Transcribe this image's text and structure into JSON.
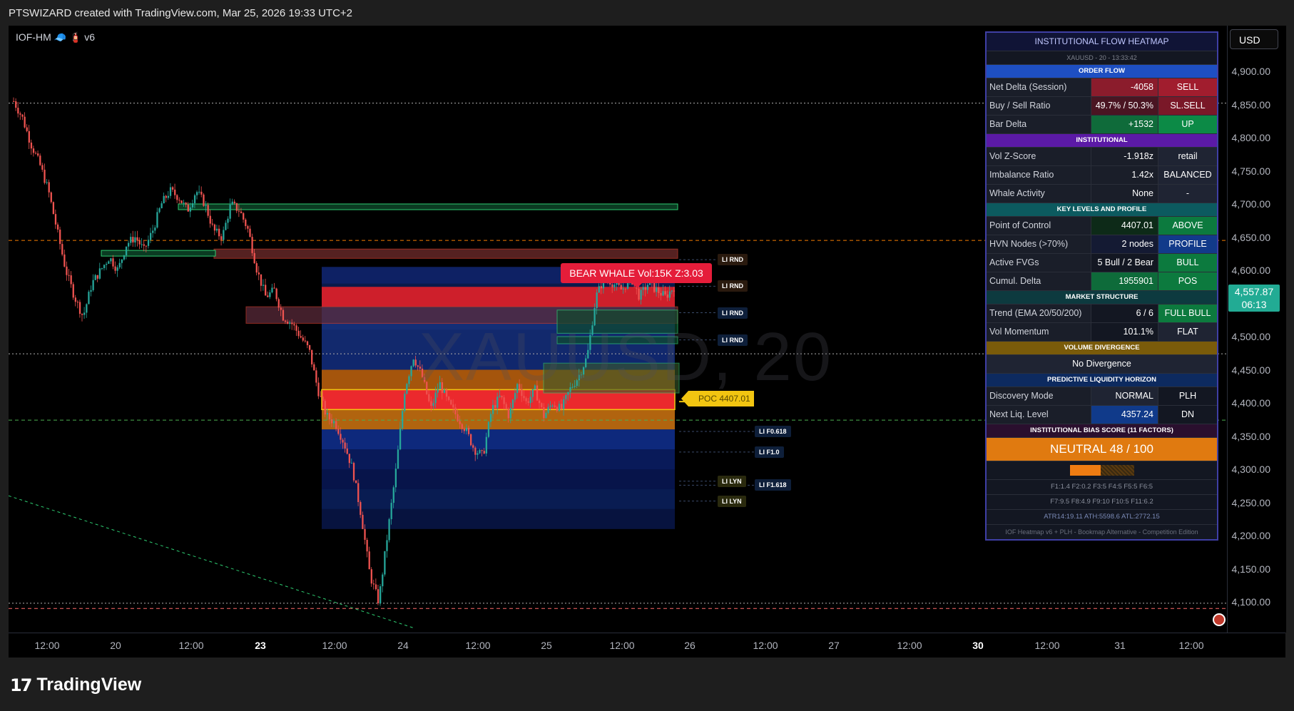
{
  "header": {
    "title": "PTSWIZARD created with TradingView.com, Mar 25, 2026 19:33 UTC+2"
  },
  "indicator_label": "IOF-HM 🧢 🧯 v6",
  "currency_button": "USD",
  "watermark": "XAUUSD, 20",
  "brand": {
    "logo_text": "TradingView",
    "logo_mark": "17"
  },
  "last_price": {
    "value": "4,557.87",
    "countdown": "06:13"
  },
  "annotations": {
    "whale": "BEAR WHALE Vol:15K Z:3.03",
    "poc": "POC 4407.01",
    "levels": [
      {
        "label": "LI RND",
        "price": 4616
      },
      {
        "label": "LI RND",
        "price": 4576
      },
      {
        "label": "LI RND",
        "price": 4536
      },
      {
        "label": "LI RND",
        "price": 4495
      },
      {
        "label": "LI F0.618",
        "price": 4357
      },
      {
        "label": "LI F1.0",
        "price": 4326
      },
      {
        "label": "LI LYN",
        "price": 4282
      },
      {
        "label": "LI F1.618",
        "price": 4276
      },
      {
        "label": "LI LYN",
        "price": 4252
      }
    ]
  },
  "chart_data": {
    "type": "candlestick",
    "symbol": "XAUUSD",
    "timeframe": "20",
    "ylim": [
      4060,
      4960
    ],
    "y_ticks": [
      "4,900.00",
      "4,850.00",
      "4,800.00",
      "4,750.00",
      "4,700.00",
      "4,650.00",
      "4,600.00",
      "4,550.00",
      "4,500.00",
      "4,450.00",
      "4,400.00",
      "4,350.00",
      "4,300.00",
      "4,250.00",
      "4,200.00",
      "4,150.00",
      "4,100.00"
    ],
    "x_ticks": [
      {
        "label": "12:00",
        "bold": false
      },
      {
        "label": "20",
        "bold": false
      },
      {
        "label": "12:00",
        "bold": false
      },
      {
        "label": "23",
        "bold": true
      },
      {
        "label": "12:00",
        "bold": false
      },
      {
        "label": "24",
        "bold": false
      },
      {
        "label": "12:00",
        "bold": false
      },
      {
        "label": "25",
        "bold": false
      },
      {
        "label": "12:00",
        "bold": false
      },
      {
        "label": "26",
        "bold": false
      },
      {
        "label": "12:00",
        "bold": false
      },
      {
        "label": "27",
        "bold": false
      },
      {
        "label": "12:00",
        "bold": false
      },
      {
        "label": "30",
        "bold": true
      },
      {
        "label": "12:00",
        "bold": false
      },
      {
        "label": "31",
        "bold": false
      },
      {
        "label": "12:00",
        "bold": false
      }
    ],
    "price_path": [
      4855,
      4830,
      4790,
      4760,
      4720,
      4660,
      4600,
      4560,
      4530,
      4580,
      4600,
      4620,
      4600,
      4640,
      4650,
      4630,
      4660,
      4700,
      4720,
      4710,
      4690,
      4720,
      4700,
      4660,
      4650,
      4700,
      4690,
      4660,
      4600,
      4560,
      4570,
      4530,
      4520,
      4500,
      4480,
      4420,
      4380,
      4370,
      4340,
      4300,
      4230,
      4140,
      4100,
      4200,
      4300,
      4420,
      4470,
      4440,
      4390,
      4430,
      4400,
      4380,
      4360,
      4330,
      4320,
      4390,
      4410,
      4380,
      4430,
      4400,
      4420,
      4380,
      4400,
      4390,
      4420,
      4440,
      4470,
      4560,
      4590,
      4580,
      4570,
      4590,
      4560,
      4580,
      4570,
      4560,
      4575
    ],
    "horizontal_lines": [
      {
        "price": 4852,
        "style": "dotted",
        "color": "#b0b0b0"
      },
      {
        "price": 4645,
        "style": "dashed",
        "color": "#f57c00"
      },
      {
        "price": 4474,
        "style": "dotted",
        "color": "#b0b0b0"
      },
      {
        "price": 4374,
        "style": "dashed",
        "color": "#4caf50"
      },
      {
        "price": 4090,
        "style": "dashed",
        "color": "#ff6b6b"
      },
      {
        "price": 4098,
        "style": "dotted",
        "color": "#b0b0b0"
      }
    ]
  },
  "panel": {
    "title": "INSTITUTIONAL FLOW HEATMAP",
    "subtitle": "XAUUSD - 20 - 13:33:42",
    "sections": [
      {
        "header": "ORDER FLOW",
        "color": "#1e4fc2",
        "rows": [
          {
            "label": "Net Delta (Session)",
            "value": "-4058",
            "status": "SELL",
            "vbg": "#8b1c2c",
            "sbg": "#a11d2e"
          },
          {
            "label": "Buy / Sell Ratio",
            "value": "49.7% / 50.3%",
            "status": "SL.SELL",
            "vbg": "#4a1522",
            "sbg": "#7a1828"
          },
          {
            "label": "Bar Delta",
            "value": "+1532",
            "status": "UP",
            "vbg": "#0f6b3a",
            "sbg": "#0c8a46"
          }
        ]
      },
      {
        "header": "INSTITUTIONAL",
        "color": "#5b1aa6",
        "rows": [
          {
            "label": "Vol Z-Score",
            "value": "-1.918z",
            "status": "retail",
            "vbg": "#1a1e29",
            "sbg": "#1f2433"
          },
          {
            "label": "Imbalance Ratio",
            "value": "1.42x",
            "status": "BALANCED",
            "vbg": "#1a1e29",
            "sbg": "#1f2433"
          },
          {
            "label": "Whale Activity",
            "value": "None",
            "status": "-",
            "vbg": "#1a1e29",
            "sbg": "#1f2433"
          }
        ]
      },
      {
        "header": "KEY LEVELS AND PROFILE",
        "color": "#0c5a5f",
        "rows": [
          {
            "label": "Point of Control",
            "value": "4407.01",
            "status": "ABOVE",
            "vbg": "#0d2a18",
            "sbg": "#0c7a3e"
          },
          {
            "label": "HVN Nodes (>70%)",
            "value": "2 nodes",
            "status": "PROFILE",
            "vbg": "#141a33",
            "sbg": "#123a8a"
          },
          {
            "label": "Active FVGs",
            "value": "5 Bull / 2 Bear",
            "status": "BULL",
            "vbg": "#131722",
            "sbg": "#0c7a3e"
          },
          {
            "label": "Cumul. Delta",
            "value": "1955901",
            "status": "POS",
            "vbg": "#0e6b3a",
            "sbg": "#0c7a3e"
          }
        ]
      },
      {
        "header": "MARKET STRUCTURE",
        "color": "#0d3a3f",
        "rows": [
          {
            "label": "Trend (EMA 20/50/200)",
            "value": "6 / 6",
            "status": "FULL BULL",
            "vbg": "#131722",
            "sbg": "#0c7a3e"
          },
          {
            "label": "Vol Momentum",
            "value": "101.1%",
            "status": "FLAT",
            "vbg": "#131722",
            "sbg": "#1f2433"
          }
        ]
      }
    ],
    "divergence": {
      "header": "VOLUME DIVERGENCE",
      "value": "No Divergence"
    },
    "liquidity": {
      "header": "PREDICTIVE LIQUIDITY HORIZON",
      "rows": [
        {
          "label": "Discovery Mode",
          "value": "NORMAL",
          "status": "PLH",
          "vbg": "#1f2433",
          "sbg": "#131722"
        },
        {
          "label": "Next Liq. Level",
          "value": "4357.24",
          "status": "DN",
          "vbg": "#103a8a",
          "sbg": "#131722"
        }
      ]
    },
    "bias": {
      "header": "INSTITUTIONAL BIAS SCORE (11 FACTORS)",
      "label": "NEUTRAL  48 / 100",
      "score": 48,
      "factors_1": "F1:1.4 F2:0.2 F3:5 F4:5 F5:5 F6:5",
      "factors_2": "F7:9.5 F8:4.9 F9:10 F10:5 F11:6.2",
      "stats": "ATR14:19.11  ATH:5598.6  ATL:2772.15",
      "footer": "IOF Heatmap v6 + PLH  -  Bookmap Alternative  -  Competition Edition"
    }
  }
}
